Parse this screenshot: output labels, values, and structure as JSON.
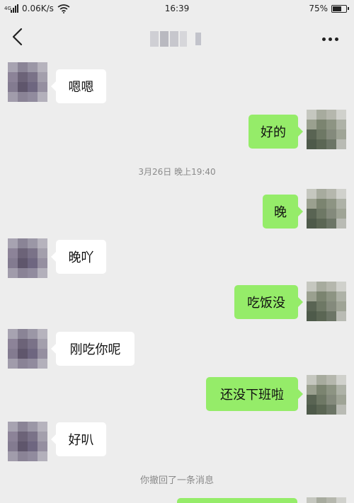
{
  "status_bar": {
    "network_speed": "0.06K/s",
    "time": "16:39",
    "battery": "75%",
    "battery_level": 0.75
  },
  "nav": {
    "back_icon": "chevron-left-icon",
    "more_icon": "more-dots-icon"
  },
  "colors": {
    "background": "#ededed",
    "bubble_self": "#95ec69",
    "bubble_other": "#ffffff"
  },
  "messages": [
    {
      "from": "other",
      "text": "嗯嗯"
    },
    {
      "from": "self",
      "text": "好的"
    },
    {
      "type": "timestamp",
      "text": "3月26日 晚上19:40"
    },
    {
      "from": "self",
      "text": "晚"
    },
    {
      "from": "other",
      "text": "晚吖"
    },
    {
      "from": "self",
      "text": "吃饭没"
    },
    {
      "from": "other",
      "text": "刚吃你呢"
    },
    {
      "from": "self",
      "text": "还没下班啦"
    },
    {
      "from": "other",
      "text": "好叭"
    },
    {
      "type": "system",
      "text": "你撤回了一条消息"
    }
  ]
}
